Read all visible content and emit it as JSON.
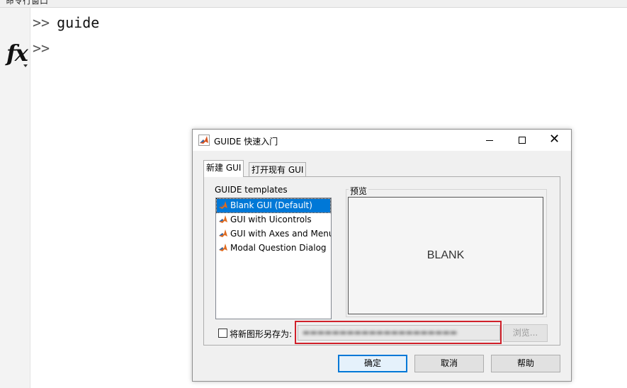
{
  "command_window": {
    "title": "命令行窗口",
    "fx_label": "fx",
    "lines": [
      {
        "prompt": ">>",
        "text": "guide"
      },
      {
        "prompt": ">>",
        "text": ""
      }
    ]
  },
  "dialog": {
    "title": "GUIDE 快速入门",
    "window_controls": {
      "minimize": "—",
      "maximize": "☐",
      "close": "✕"
    },
    "tabs": [
      {
        "label": "新建 GUI",
        "active": true
      },
      {
        "label": "打开现有 GUI",
        "active": false
      }
    ],
    "templates_label": "GUIDE templates",
    "templates": [
      {
        "label": "Blank GUI (Default)",
        "selected": true
      },
      {
        "label": "GUI with Uicontrols",
        "selected": false
      },
      {
        "label": "GUI with Axes and Menu",
        "selected": false
      },
      {
        "label": "Modal Question Dialog",
        "selected": false
      }
    ],
    "preview_label": "预览",
    "preview_text": "BLANK",
    "save_as_label": "将新图形另存为:",
    "save_as_checked": false,
    "browse_label": "浏览...",
    "buttons": {
      "ok": "确定",
      "cancel": "取消",
      "help": "帮助"
    }
  },
  "colors": {
    "selection": "#0078d7",
    "highlight_border": "#d0202a"
  }
}
